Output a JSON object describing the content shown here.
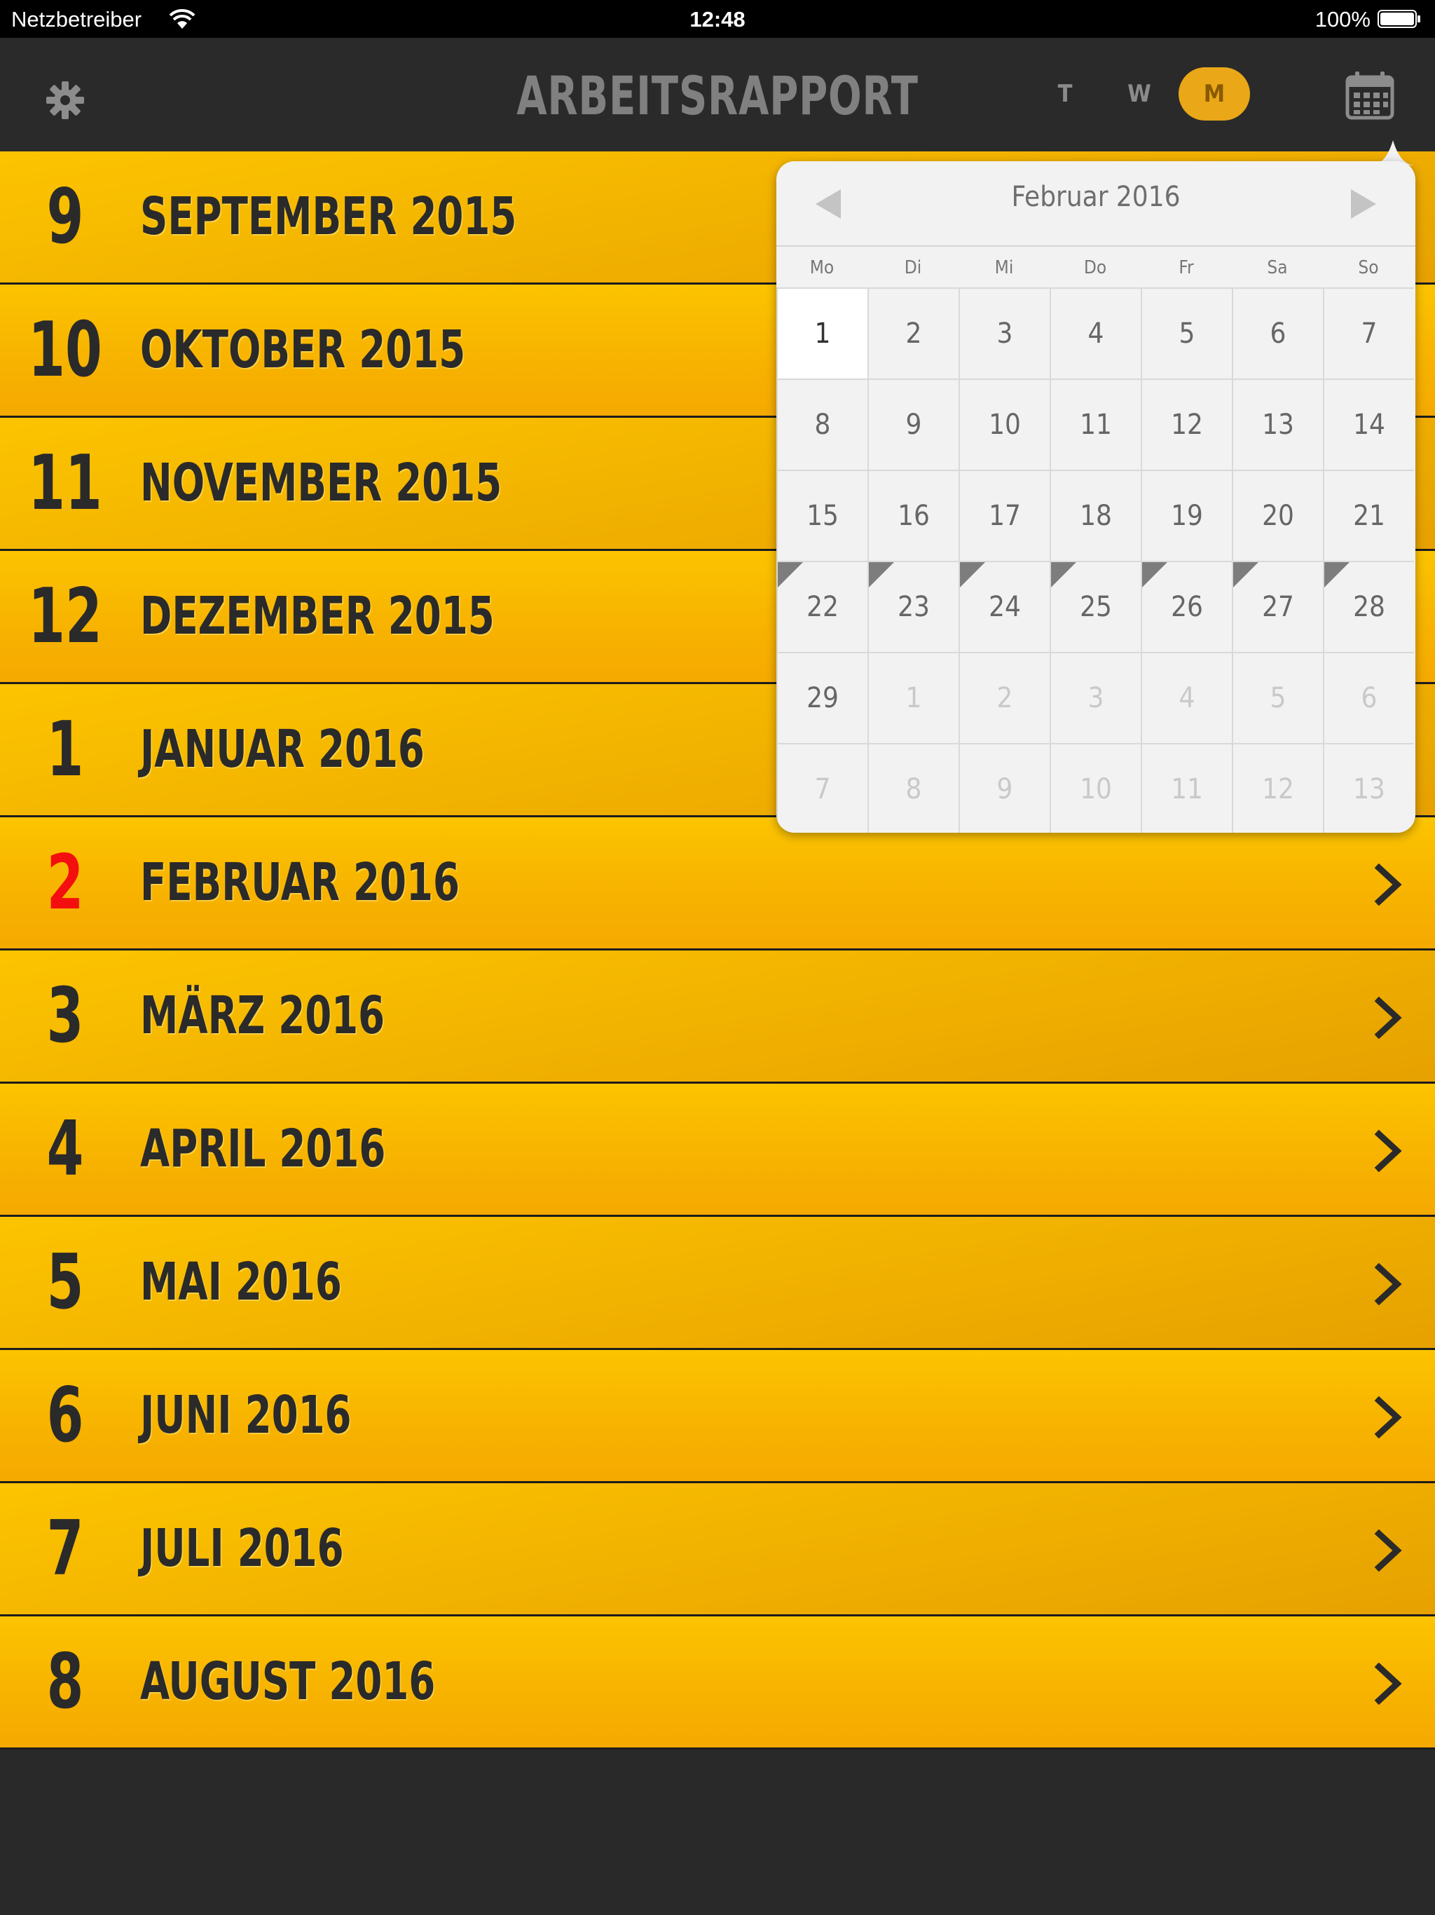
{
  "status_bar": {
    "carrier": "Netzbetreiber",
    "time": "12:48",
    "battery": "100%"
  },
  "nav": {
    "title": "ARBEITSRAPPORT",
    "segments": [
      "T",
      "W",
      "M"
    ],
    "selected_segment": "M",
    "accent_color": "#eaa717"
  },
  "months": [
    {
      "num": "9",
      "label": "SEPTEMBER 2015"
    },
    {
      "num": "10",
      "label": "OKTOBER 2015"
    },
    {
      "num": "11",
      "label": "NOVEMBER 2015"
    },
    {
      "num": "12",
      "label": "DEZEMBER 2015"
    },
    {
      "num": "1",
      "label": "JANUAR 2016"
    },
    {
      "num": "2",
      "label": "FEBRUAR 2016",
      "current": true
    },
    {
      "num": "3",
      "label": "MÄRZ 2016"
    },
    {
      "num": "4",
      "label": "APRIL 2016"
    },
    {
      "num": "5",
      "label": "MAI 2016"
    },
    {
      "num": "6",
      "label": "JUNI 2016"
    },
    {
      "num": "7",
      "label": "JULI 2016"
    },
    {
      "num": "8",
      "label": "AUGUST 2016"
    }
  ],
  "calendar": {
    "month_title": "Februar 2016",
    "weekdays": [
      "Mo",
      "Di",
      "Mi",
      "Do",
      "Fr",
      "Sa",
      "So"
    ],
    "days": [
      [
        "1",
        "2",
        "3",
        "4",
        "5",
        "6",
        "7"
      ],
      [
        "8",
        "9",
        "10",
        "11",
        "12",
        "13",
        "14"
      ],
      [
        "15",
        "16",
        "17",
        "18",
        "19",
        "20",
        "21"
      ],
      [
        "22",
        "23",
        "24",
        "25",
        "26",
        "27",
        "28"
      ],
      [
        "29",
        "1",
        "2",
        "3",
        "4",
        "5",
        "6"
      ],
      [
        "7",
        "8",
        "9",
        "10",
        "11",
        "12",
        "13"
      ]
    ],
    "selected_day": "1",
    "marked_days": [
      "22",
      "23",
      "24",
      "25",
      "26",
      "27",
      "28"
    ]
  },
  "icons": {
    "settings": "gear-icon",
    "calendar": "calendar-icon",
    "row_arrow": "chevron-right-icon",
    "prev": "triangle-left-icon",
    "next": "triangle-right-icon"
  },
  "colors": {
    "row_yellow": "#fcc400",
    "current_month_red": "#f30f0f",
    "background": "#292929"
  }
}
